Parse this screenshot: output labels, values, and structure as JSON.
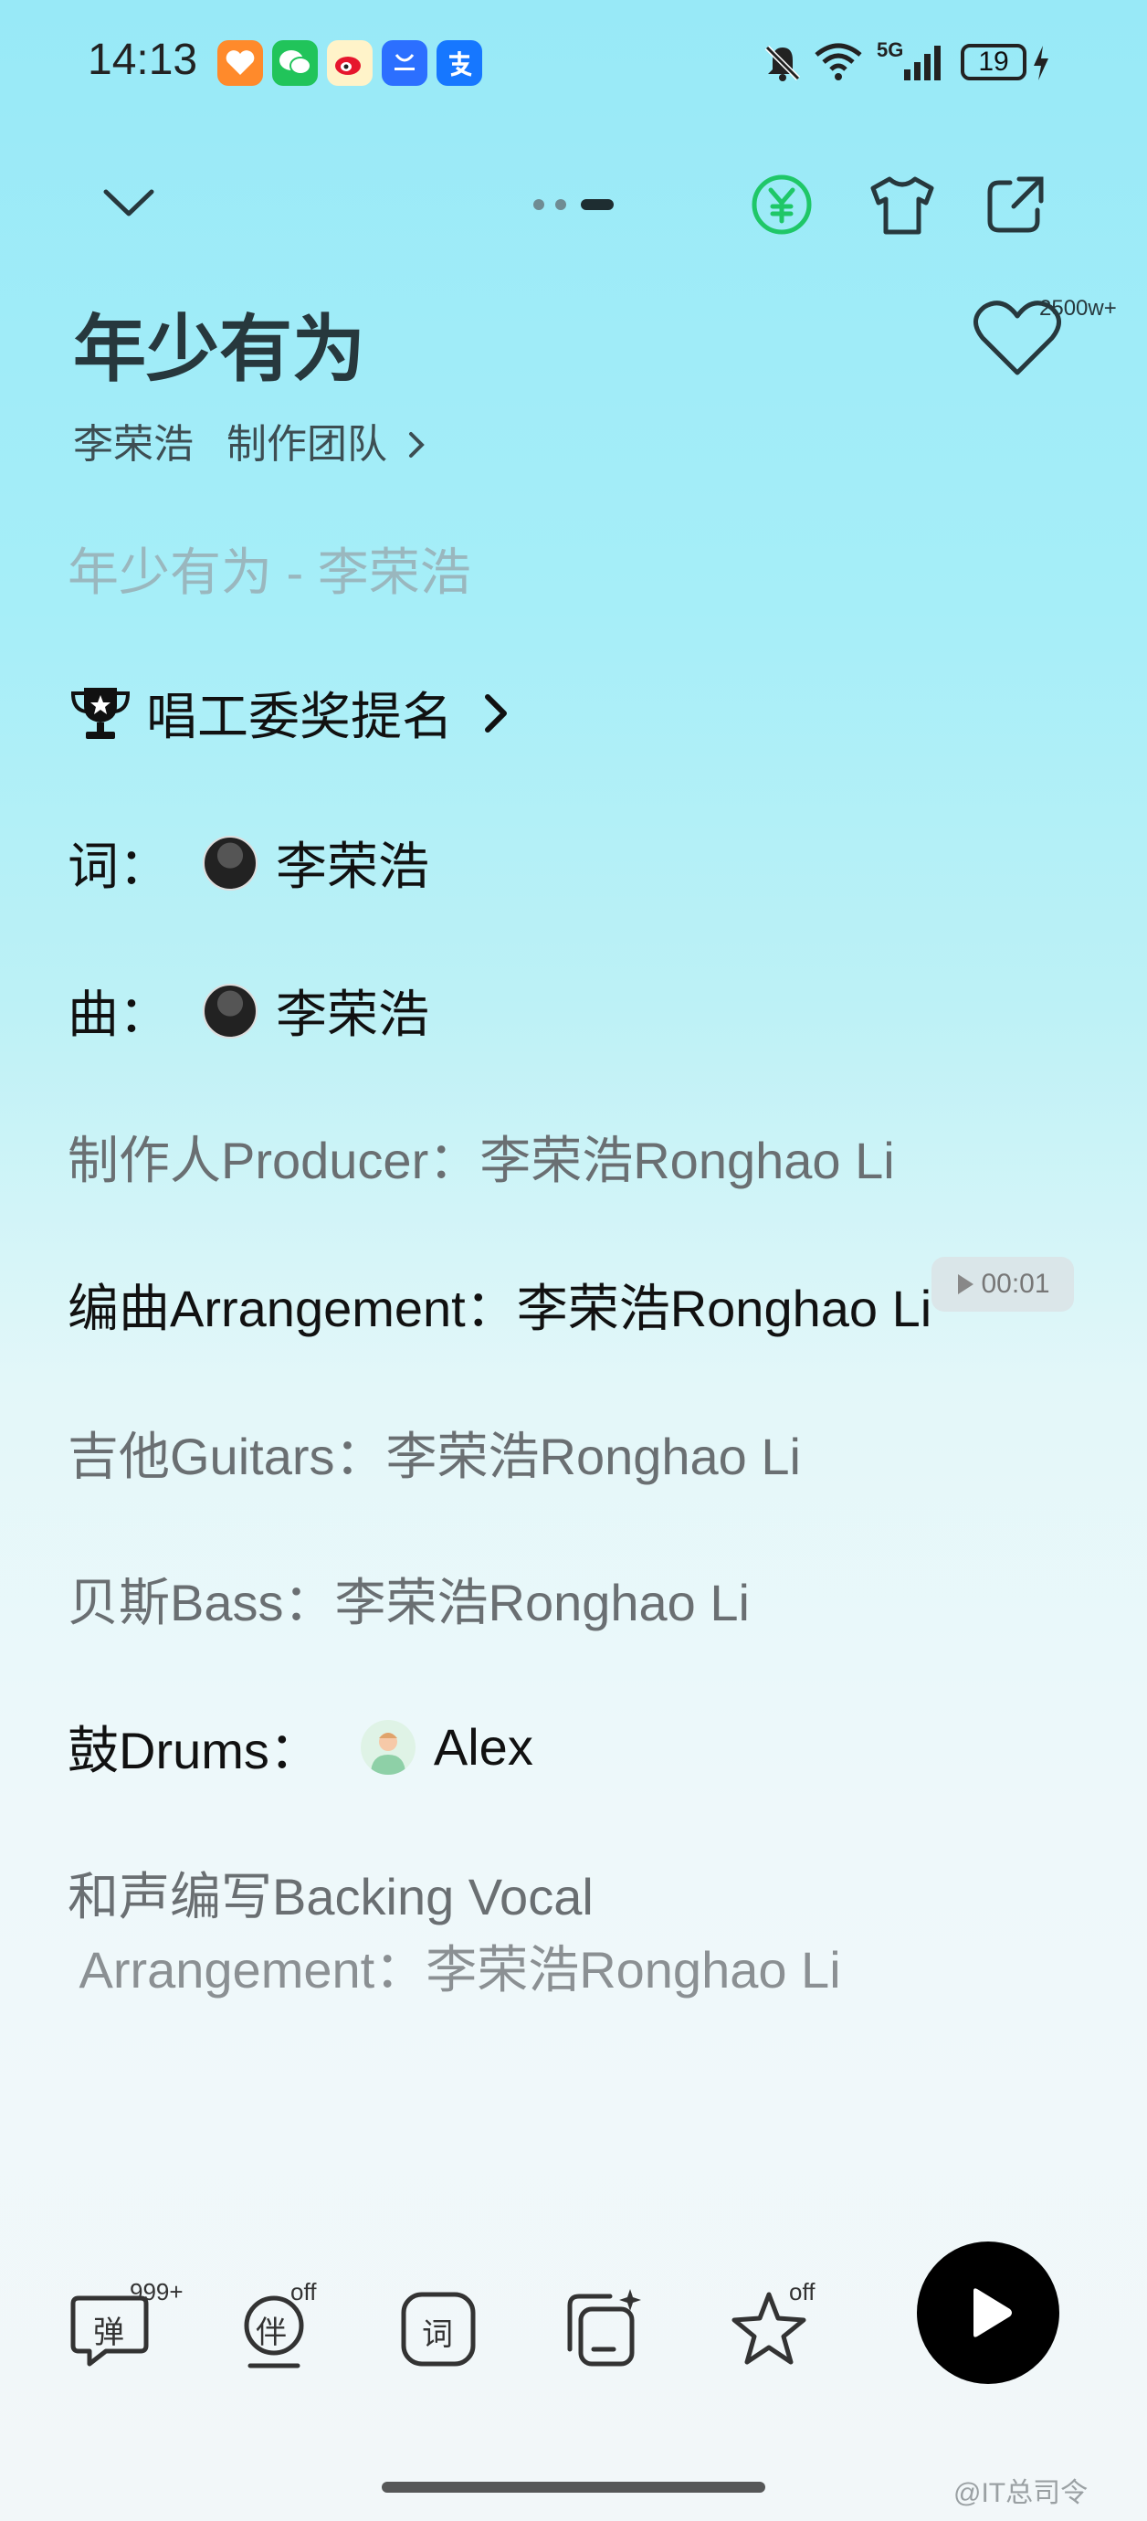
{
  "status_bar": {
    "time": "14:13",
    "battery": "19",
    "network": "5G"
  },
  "status_apps": [
    "health-icon",
    "wechat-icon",
    "weibo-icon",
    "appmarket-icon",
    "alipay-icon"
  ],
  "header": {
    "page_dots": 3
  },
  "song": {
    "title": "年少有为",
    "artist": "李荣浩",
    "credits_link": "制作团队",
    "like_count": "2500w+"
  },
  "lyrics": {
    "line0": "年少有为 - 李荣浩",
    "award": "唱工委奖提名",
    "lyricist_label": "词：",
    "lyricist_name": "李荣浩",
    "composer_label": "曲：",
    "composer_name": "李荣浩",
    "producer": "制作人Producer：李荣浩Ronghao Li",
    "arrangement": "编曲Arrangement：李荣浩Ronghao Li",
    "guitars": "吉他Guitars：李荣浩Ronghao Li",
    "bass": "贝斯Bass：李荣浩Ronghao Li",
    "drums_label": "鼓Drums：",
    "drums_name": "Alex",
    "backing_1": "和声编写Backing Vocal",
    "backing_2": " Arrangement：李荣浩Ronghao Li"
  },
  "seek_time": "00:01",
  "toolbar": {
    "danmu_label": "弹",
    "danmu_badge": "999+",
    "accomp_label": "伴",
    "accomp_badge": "off",
    "lyrics_label": "词",
    "fav_badge": "off"
  },
  "watermark": "@IT总司令"
}
